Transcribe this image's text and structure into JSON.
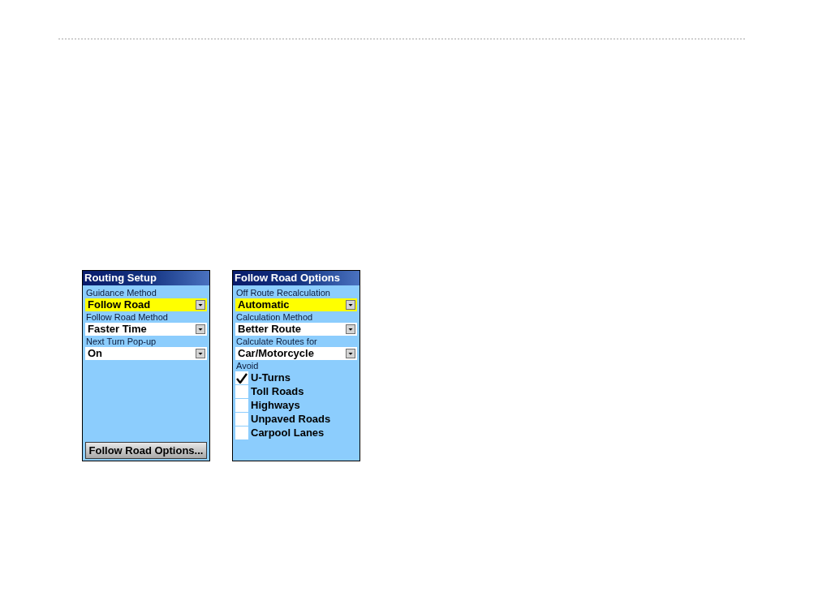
{
  "screens": [
    {
      "title": "Routing Setup",
      "fields": [
        {
          "label": "Guidance Method",
          "value": "Follow Road",
          "selected": true
        },
        {
          "label": "Follow Road Method",
          "value": "Faster Time",
          "selected": false
        },
        {
          "label": "Next Turn Pop-up",
          "value": "On",
          "selected": false
        }
      ],
      "button": "Follow Road Options..."
    },
    {
      "title": "Follow Road Options",
      "fields": [
        {
          "label": "Off Route Recalculation",
          "value": "Automatic",
          "selected": true
        },
        {
          "label": "Calculation Method",
          "value": "Better Route",
          "selected": false
        },
        {
          "label": "Calculate Routes for",
          "value": "Car/Motorcycle",
          "selected": false
        }
      ],
      "avoid": {
        "label": "Avoid",
        "items": [
          {
            "label": "U-Turns",
            "checked": true
          },
          {
            "label": "Toll Roads",
            "checked": false
          },
          {
            "label": "Highways",
            "checked": false
          },
          {
            "label": "Unpaved Roads",
            "checked": false
          },
          {
            "label": "Carpool Lanes",
            "checked": false
          }
        ]
      }
    }
  ]
}
